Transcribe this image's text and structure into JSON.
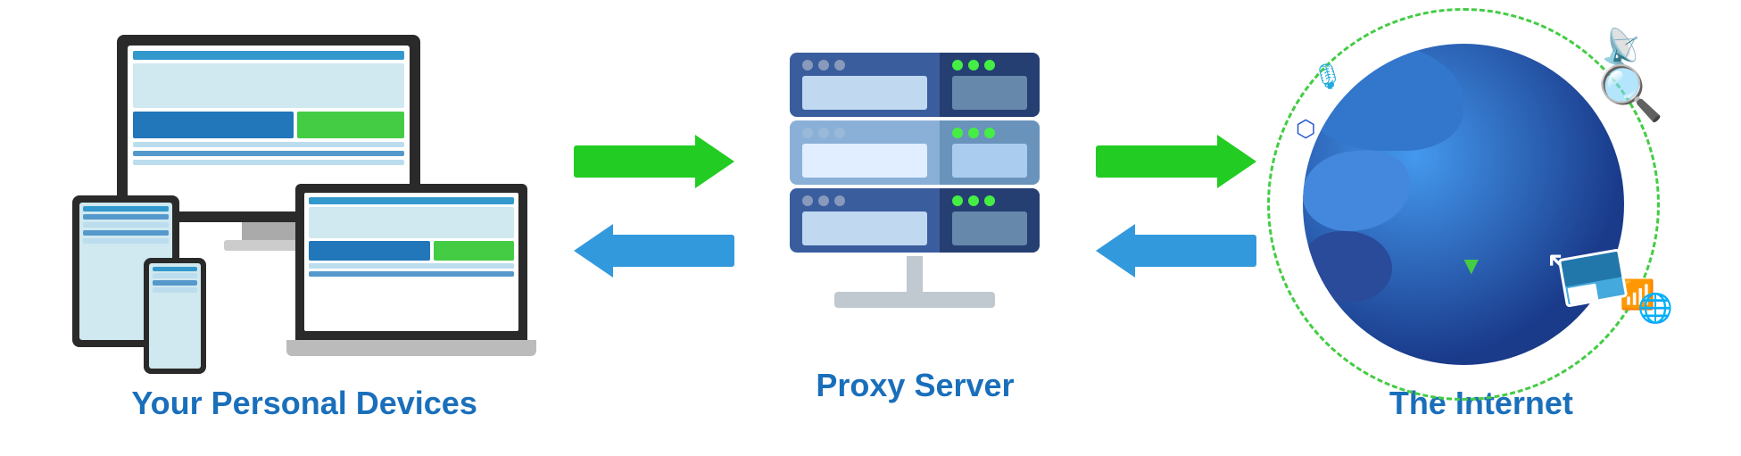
{
  "labels": {
    "devices": "Your Personal Devices",
    "proxy": "Proxy Server",
    "internet": "The Internet"
  },
  "arrows": {
    "to_proxy_label": "→",
    "from_proxy_label": "←",
    "to_internet_label": "→",
    "from_internet_label": "←"
  }
}
